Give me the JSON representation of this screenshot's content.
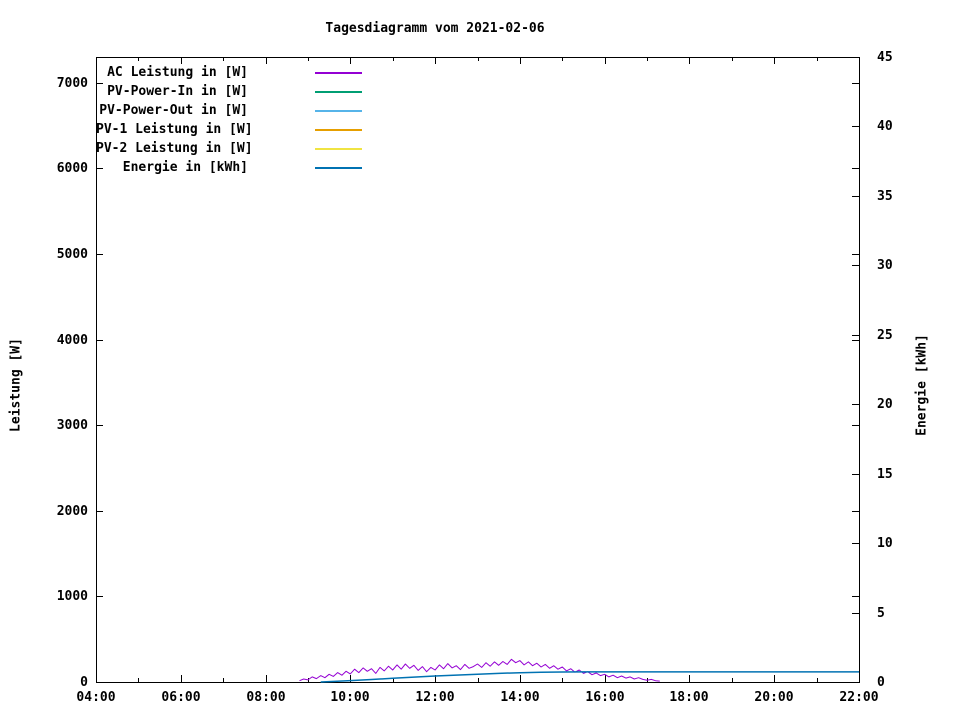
{
  "title": "Tagesdiagramm vom 2021-02-06",
  "chart_data": {
    "type": "line",
    "title": "Tagesdiagramm vom 2021-02-06",
    "ylabel": "Leistung [W]",
    "y2label": "Energie [kWh]",
    "background_color": "#ffffff",
    "axis_color": "#000000",
    "grid": false,
    "legend_position": "top-left-inside",
    "x_range_hours": [
      4,
      22
    ],
    "y1_range": [
      0,
      7300
    ],
    "y2_range": [
      0,
      45
    ],
    "x_major_hours": [
      4,
      6,
      8,
      10,
      12,
      14,
      16,
      18,
      20,
      22
    ],
    "x_major_tick_labels": [
      "04:00",
      "06:00",
      "08:00",
      "10:00",
      "12:00",
      "14:00",
      "16:00",
      "18:00",
      "20:00",
      "22:00"
    ],
    "x_minor_hours": [
      5,
      7,
      9,
      11,
      13,
      15,
      17,
      19,
      21
    ],
    "y1_ticks": [
      0,
      1000,
      2000,
      3000,
      4000,
      5000,
      6000,
      7000
    ],
    "y2_ticks": [
      0,
      5,
      10,
      15,
      20,
      25,
      30,
      35,
      40,
      45
    ],
    "series": [
      {
        "name": "ac-leistung",
        "label": "AC Leistung in [W]",
        "color": "#9400d3",
        "axis": "y1",
        "line_width": 1,
        "t_start": 8.8,
        "t_step": 0.1,
        "values": [
          15,
          35,
          25,
          60,
          40,
          75,
          50,
          90,
          65,
          110,
          80,
          125,
          95,
          150,
          110,
          165,
          125,
          155,
          100,
          170,
          130,
          185,
          140,
          200,
          150,
          210,
          160,
          195,
          135,
          180,
          120,
          170,
          140,
          200,
          155,
          215,
          165,
          190,
          145,
          205,
          160,
          180,
          210,
          170,
          225,
          185,
          235,
          195,
          240,
          205,
          265,
          225,
          250,
          200,
          235,
          190,
          220,
          175,
          205,
          160,
          190,
          150,
          175,
          130,
          155,
          115,
          140,
          100,
          120,
          85,
          105,
          75,
          90,
          60,
          80,
          50,
          70,
          45,
          60,
          35,
          50,
          30,
          20,
          30,
          15,
          10
        ]
      },
      {
        "name": "pv-power-in",
        "label": "PV-Power-In in [W]",
        "color": "#009e73",
        "axis": "y1",
        "line_width": 1,
        "t": [],
        "v": []
      },
      {
        "name": "pv-power-out",
        "label": "PV-Power-Out in [W]",
        "color": "#56b4e9",
        "axis": "y1",
        "line_width": 1,
        "t": [],
        "v": []
      },
      {
        "name": "pv-1-leistung",
        "label": "PV-1 Leistung in [W]",
        "color": "#e69f00",
        "axis": "y1",
        "line_width": 1,
        "t": [],
        "v": []
      },
      {
        "name": "pv-2-leistung",
        "label": "PV-2 Leistung in [W]",
        "color": "#f0e442",
        "axis": "y1",
        "line_width": 1,
        "t": [],
        "v": []
      },
      {
        "name": "energie",
        "label": "Energie in [kWh]",
        "color": "#0072b2",
        "axis": "y2",
        "line_width": 1.5,
        "t": [
          9.3,
          9.5,
          10.0,
          10.5,
          11.0,
          11.5,
          12.0,
          12.5,
          13.0,
          13.5,
          14.0,
          14.5,
          15.0,
          15.5,
          16.0,
          16.5,
          22.0
        ],
        "v": [
          0,
          0.03,
          0.1,
          0.18,
          0.27,
          0.35,
          0.43,
          0.5,
          0.56,
          0.62,
          0.67,
          0.7,
          0.72,
          0.73,
          0.73,
          0.73,
          0.73
        ]
      }
    ]
  }
}
